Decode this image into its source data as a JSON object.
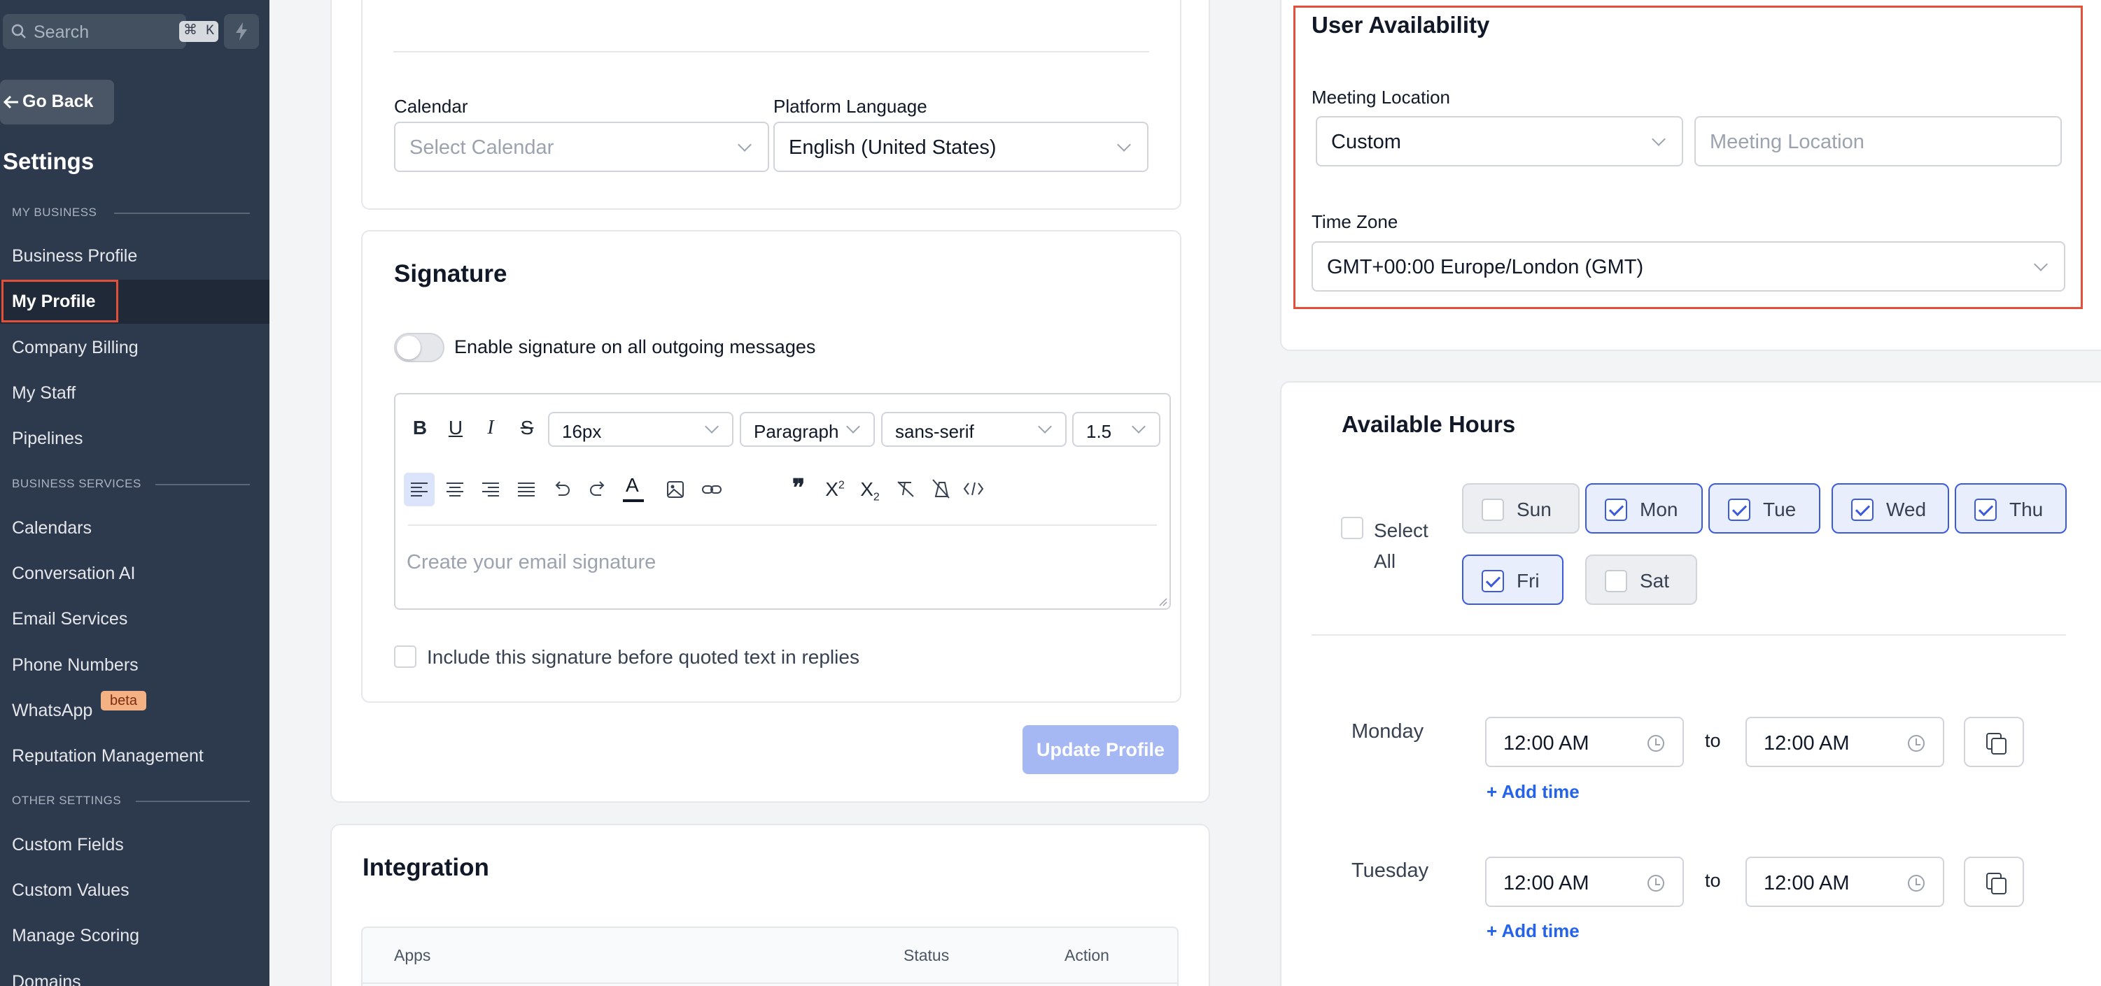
{
  "sidebar": {
    "search_label": "Search",
    "search_shortcut": "⌘ K",
    "go_back": "Go Back",
    "title": "Settings",
    "sections": {
      "my_business": "MY BUSINESS",
      "business_services": "BUSINESS SERVICES",
      "other_settings": "OTHER SETTINGS"
    },
    "items": {
      "business_profile": "Business Profile",
      "my_profile": "My Profile",
      "company_billing": "Company Billing",
      "my_staff": "My Staff",
      "pipelines": "Pipelines",
      "calendars": "Calendars",
      "conversation_ai": "Conversation AI",
      "email_services": "Email Services",
      "phone_numbers": "Phone Numbers",
      "whatsapp": "WhatsApp",
      "whatsapp_badge": "beta",
      "reputation_management": "Reputation Management",
      "custom_fields": "Custom Fields",
      "custom_values": "Custom Values",
      "manage_scoring": "Manage Scoring",
      "domains": "Domains"
    }
  },
  "profile": {
    "calendar_label": "Calendar",
    "calendar_placeholder": "Select Calendar",
    "language_label": "Platform Language",
    "language_value": "English (United States)"
  },
  "signature": {
    "title": "Signature",
    "enable_label": "Enable signature on all outgoing messages",
    "font_size": "16px",
    "block_type": "Paragraph",
    "font_family": "sans-serif",
    "line_height": "1.5",
    "placeholder": "Create your email signature",
    "include_label": "Include this signature before quoted text in replies",
    "update_button": "Update Profile"
  },
  "integration": {
    "title": "Integration",
    "columns": {
      "apps": "Apps",
      "status": "Status",
      "action": "Action"
    }
  },
  "availability": {
    "title": "User Availability",
    "meeting_location_label": "Meeting Location",
    "meeting_type": "Custom",
    "meeting_location_placeholder": "Meeting Location",
    "timezone_label": "Time Zone",
    "timezone_value": "GMT+00:00 Europe/London (GMT)"
  },
  "hours": {
    "title": "Available Hours",
    "select_all": "Select All",
    "days": [
      {
        "label": "Sun",
        "checked": false
      },
      {
        "label": "Mon",
        "checked": true
      },
      {
        "label": "Tue",
        "checked": true
      },
      {
        "label": "Wed",
        "checked": true
      },
      {
        "label": "Thu",
        "checked": true
      },
      {
        "label": "Fri",
        "checked": true
      },
      {
        "label": "Sat",
        "checked": false
      }
    ],
    "rows": [
      {
        "day": "Monday",
        "from": "12:00 AM",
        "to_label": "to",
        "to": "12:00 AM",
        "add_time": "+ Add time"
      },
      {
        "day": "Tuesday",
        "from": "12:00 AM",
        "to_label": "to",
        "to": "12:00 AM",
        "add_time": "+ Add time"
      }
    ]
  },
  "colors": {
    "sidebar_bg": "#2d3a4d",
    "highlight_red": "#e2503a",
    "accent_blue": "#3b5bdb",
    "update_button_bg": "#a5b8f3",
    "beta_badge": "#f4b183"
  }
}
